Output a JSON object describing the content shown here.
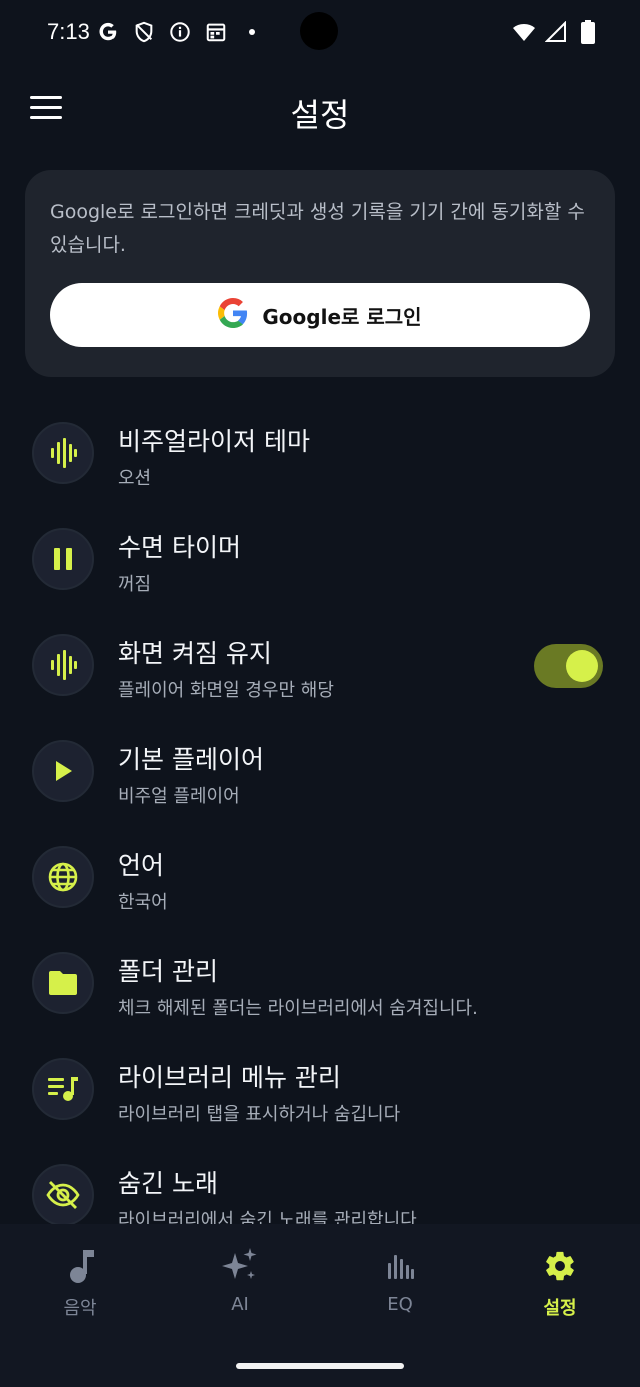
{
  "status_bar": {
    "time": "7:13"
  },
  "app_bar": {
    "title": "설정"
  },
  "google_card": {
    "description": "Google로 로그인하면 크레딧과 생성 기록을 기기 간에 동기화할 수 있습니다.",
    "button_label": "Google로 로그인"
  },
  "settings": [
    {
      "title": "비주얼라이저 테마",
      "subtitle": "오션",
      "icon": "visualizer-bars-icon"
    },
    {
      "title": "수면 타이머",
      "subtitle": "꺼짐",
      "icon": "pause-icon"
    },
    {
      "title": "화면 켜짐 유지",
      "subtitle": "플레이어 화면일 경우만 해당",
      "icon": "visualizer-bars-icon",
      "toggle_on": true
    },
    {
      "title": "기본 플레이어",
      "subtitle": "비주얼 플레이어",
      "icon": "play-icon"
    },
    {
      "title": "언어",
      "subtitle": "한국어",
      "icon": "globe-icon"
    },
    {
      "title": "폴더 관리",
      "subtitle": "체크 해제된 폴더는 라이브러리에서 숨겨집니다.",
      "icon": "folder-icon"
    },
    {
      "title": "라이브러리 메뉴 관리",
      "subtitle": "라이브러리 탭을 표시하거나 숨깁니다",
      "icon": "playlist-music-icon"
    },
    {
      "title": "숨긴 노래",
      "subtitle": "라이브러리에서 숨긴 노래를 관리합니다",
      "icon": "eye-off-icon"
    }
  ],
  "bottom_nav": [
    {
      "label": "음악",
      "icon": "music-note-icon"
    },
    {
      "label": "AI",
      "icon": "sparkles-icon"
    },
    {
      "label": "EQ",
      "icon": "equalizer-icon"
    },
    {
      "label": "설정",
      "icon": "gear-icon",
      "active": true
    }
  ],
  "colors": {
    "background": "#0e131c",
    "card": "#1f242d",
    "accent": "#d6f04a",
    "toggle_track": "#6a7a24",
    "nav_inactive": "#7d8596"
  }
}
